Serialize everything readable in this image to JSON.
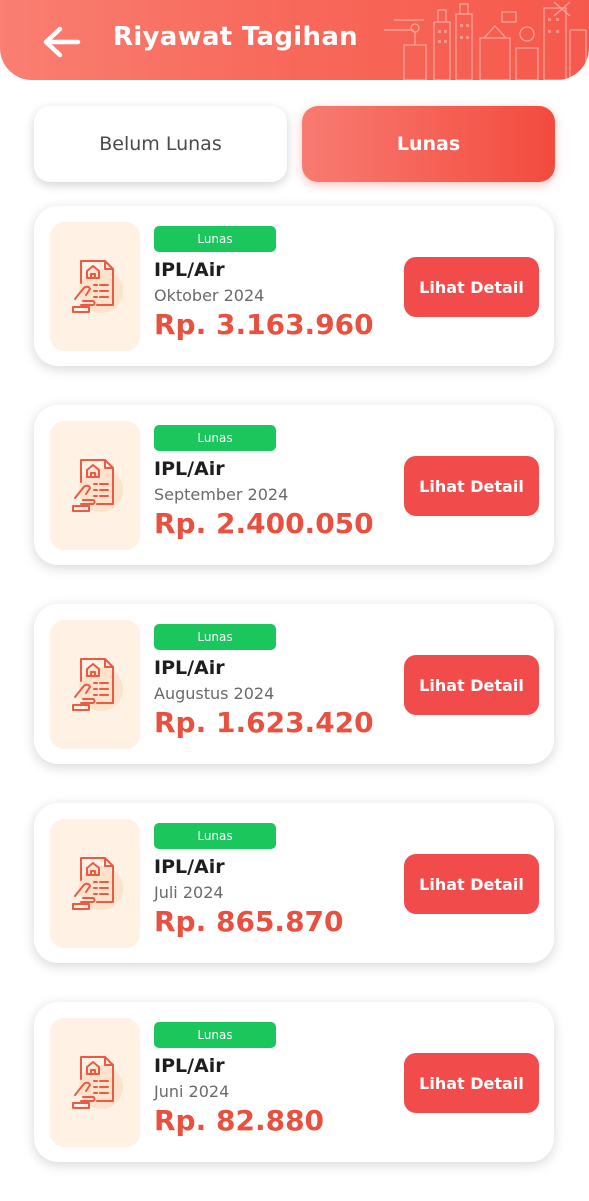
{
  "header": {
    "title": "Riyawat Tagihan",
    "back_icon": "arrow-left-icon"
  },
  "tabs": [
    {
      "label": "Belum Lunas",
      "active": false
    },
    {
      "label": "Lunas",
      "active": true
    }
  ],
  "colors": {
    "accent": "#f5594b",
    "amount": "#e8503f",
    "badge": "#1bc75d",
    "button": "#f24b4b",
    "icon_bg": "#fff1e4"
  },
  "bills": [
    {
      "status": "Lunas",
      "service": "IPL/Air",
      "period": "Oktober 2024",
      "amount": "Rp. 3.163.960",
      "button_label": "Lihat Detail",
      "icon": "bill-document-hand-icon"
    },
    {
      "status": "Lunas",
      "service": "IPL/Air",
      "period": "September 2024",
      "amount": "Rp. 2.400.050",
      "button_label": "Lihat Detail",
      "icon": "bill-document-hand-icon"
    },
    {
      "status": "Lunas",
      "service": "IPL/Air",
      "period": "Augustus 2024",
      "amount": "Rp. 1.623.420",
      "button_label": "Lihat Detail",
      "icon": "bill-document-hand-icon"
    },
    {
      "status": "Lunas",
      "service": "IPL/Air",
      "period": "Juli 2024",
      "amount": "Rp. 865.870",
      "button_label": "Lihat Detail",
      "icon": "bill-document-hand-icon"
    },
    {
      "status": "Lunas",
      "service": "IPL/Air",
      "period": "Juni 2024",
      "amount": "Rp. 82.880",
      "button_label": "Lihat Detail",
      "icon": "bill-document-hand-icon"
    }
  ]
}
